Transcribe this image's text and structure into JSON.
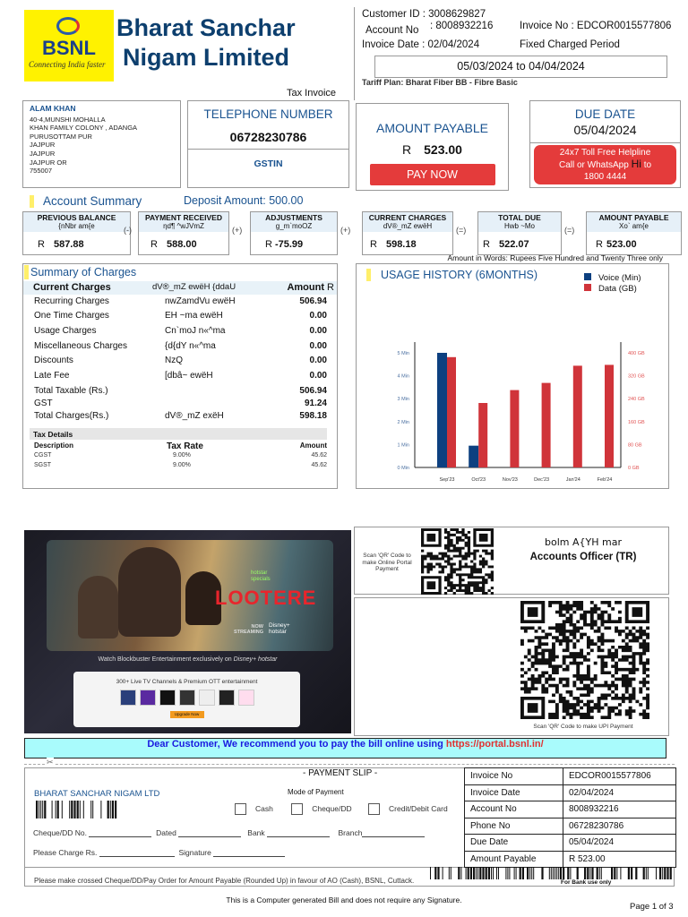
{
  "header": {
    "logo_text": "BSNL",
    "logo_tagline": "Connecting India faster",
    "company_line1": "Bharat Sanchar",
    "company_line2": "Nigam Limited",
    "tax_invoice": "Tax Invoice"
  },
  "meta": {
    "customer_id_label": "Customer ID",
    "customer_id": ": 3008629827",
    "account_no_label": "Account No",
    "account_no": ": 8008932216",
    "invoice_no": "Invoice No : EDCOR0015577806",
    "invoice_date_label": "Invoice Date",
    "invoice_date": ": 02/04/2024",
    "fixed_period_label": "Fixed Charged Period",
    "period": "05/03/2024 to 04/04/2024",
    "tariff": "Tariff Plan: Bharat Fiber BB - Fibre Basic"
  },
  "customer": {
    "name": "ALAM KHAN",
    "address": [
      "40-4,MUNSHI MOHALLA",
      "KHAN FAMILY COLONY , ADANGA",
      "PURUSOTTAM PUR",
      "JAJPUR",
      "JAJPUR",
      "JAJPUR OR",
      "755007"
    ]
  },
  "telephone": {
    "label": "TELEPHONE NUMBER",
    "number": "06728230786",
    "gstin_label": "GSTIN"
  },
  "amount": {
    "label": "AMOUNT PAYABLE",
    "currency": "R",
    "value": "523.00",
    "pay_now": "PAY NOW"
  },
  "due": {
    "label": "DUE DATE",
    "date": "05/04/2024",
    "helpline1": "24x7 Toll Free Helpline",
    "helpline2a": "Call or WhatsApp",
    "helpline2b": "Hi",
    "helpline2c": "to",
    "helpline3": "1800 4444"
  },
  "account_summary": {
    "title": "Account Summary",
    "deposit": "Deposit Amount: 500.00",
    "amount_words": "Amount in Words: Rupees Five Hundred and Twenty Three only",
    "boxes": [
      {
        "label": "PREVIOUS BALANCE",
        "sub": "{nNbr am{e",
        "value": "587.88"
      },
      {
        "label": "PAYMENT RECEIVED",
        "sub": "ηd¶ ^wJVmZ",
        "value": "588.00"
      },
      {
        "label": "ADJUSTMENTS",
        "sub": "g_m`moOZ",
        "value": "-75.99"
      },
      {
        "label": "CURRENT CHARGES",
        "sub": "dV®_mZ ewëH",
        "value": "598.18"
      },
      {
        "label": "TOTAL DUE",
        "sub": "Hwb ~Mo",
        "value": "522.07"
      },
      {
        "label": "AMOUNT PAYABLE",
        "sub": "Xo` am{e",
        "value": "523.00"
      }
    ],
    "operators": [
      "(-)",
      "(+)",
      "(+)",
      "(=)",
      "(=)"
    ],
    "currency": "R"
  },
  "charges": {
    "title": "Summary of Charges",
    "col1": "Current Charges",
    "col2": "dV®_mZ ewëH  {ddaU",
    "col3": "Amount",
    "col3_cur": "R",
    "rows": [
      {
        "label": "Recurring Charges",
        "alt": "nwZamdVu ewëH",
        "amount": "506.94"
      },
      {
        "label": "One Time Charges",
        "alt": "EH  ~ma ewëH",
        "amount": "0.00"
      },
      {
        "label": "Usage Charges",
        "alt": "Cn`moJ n«^ma",
        "amount": "0.00"
      },
      {
        "label": "Miscellaneous Charges",
        "alt": "{d{dY n«^ma",
        "amount": "0.00"
      },
      {
        "label": "Discounts",
        "alt": "NzQ",
        "amount": "0.00"
      },
      {
        "label": "Late Fee",
        "alt": "[dbâ~ ewëH",
        "amount": "0.00"
      },
      {
        "label": "Total Taxable (Rs.)",
        "alt": "",
        "amount": "506.94"
      },
      {
        "label": "GST",
        "alt": "",
        "amount": "91.24"
      },
      {
        "label": "Total Charges(Rs.)",
        "alt": "dV®_mZ exëH",
        "amount": "598.18"
      }
    ],
    "tax_title": "Tax Details",
    "tax_headers": [
      "Description",
      "Tax Rate",
      "Amount"
    ],
    "tax_rows": [
      [
        "CGST",
        "9.00%",
        "45.62"
      ],
      [
        "SGST",
        "9.00%",
        "45.62"
      ]
    ]
  },
  "chart_data": {
    "type": "bar",
    "title": "USAGE HISTORY (6MONTHS)",
    "categories": [
      "Sep'23",
      "Oct'23",
      "Nov'23",
      "Dec'23",
      "Jan'24",
      "Feb'24"
    ],
    "series": [
      {
        "name": "Voice (Min)",
        "values": [
          5,
          0.95,
          0,
          0,
          0,
          0
        ],
        "axis": "left",
        "color": "#0d4080"
      },
      {
        "name": "Data (GB)",
        "values": [
          385,
          225,
          270,
          295,
          355,
          358
        ],
        "axis": "right",
        "color": "#d0343a"
      }
    ],
    "left_ticks": [
      "0 Min",
      "1 Min",
      "2 Min",
      "3 Min",
      "4 Min",
      "5 Min"
    ],
    "right_ticks": [
      "0 GB",
      "80 GB",
      "160 GB",
      "240 GB",
      "320 GB",
      "400 GB"
    ],
    "ylim_left": [
      0,
      5
    ],
    "ylim_right": [
      0,
      400
    ],
    "legend": "top-right"
  },
  "ad": {
    "show_title": "LOOTERE",
    "brand": "hotstar specials",
    "now_streaming": "NOW STREAMING",
    "disney": "Disney+ hotstar",
    "watch": "Watch Blockbuster Entertainment exclusively on",
    "watch_brand": "Disney+ hotstar",
    "channels": "300+ Live TV Channels & Premium OTT entertainment",
    "upgrade": "Upgrade Now"
  },
  "qr": {
    "portal_caption": "Scan 'QR' Code to make Online Portal Payment",
    "signature": "bolm A{YH mar",
    "officer": "Accounts Officer (TR)",
    "upi_caption": "Scan 'QR' Code to make UPI Payment"
  },
  "banner": {
    "text": "Dear Customer, We recommend you to pay the bill online using",
    "url": "https://portal.bsnl.in/"
  },
  "slip": {
    "title": "- PAYMENT SLIP -",
    "company": "BHARAT SANCHAR NIGAM LTD",
    "mode_label": "Mode of Payment",
    "modes": [
      "Cash",
      "Cheque/DD",
      "Credit/Debit Card"
    ],
    "cheque_no": "Cheque/DD No.",
    "dated": "Dated",
    "bank": "Bank",
    "branch": "Branch",
    "charge": "Please Charge Rs.",
    "signature": "Signature",
    "note": "Please make crossed Cheque/DD/Pay Order for Amount Payable (Rounded Up) in favour of AO (Cash), BSNL, Cuttack.",
    "bank_use": "For Bank use only",
    "table": [
      [
        "Invoice No",
        "EDCOR0015577806"
      ],
      [
        "Invoice Date",
        "02/04/2024"
      ],
      [
        "Account No",
        "8008932216"
      ],
      [
        "Phone No",
        "06728230786"
      ],
      [
        "Due Date",
        "05/04/2024"
      ],
      [
        "Amount Payable",
        "R 523.00"
      ]
    ]
  },
  "footer": {
    "note": "This is a Computer generated Bill and does not require any Signature.",
    "page": "Page 1 of 3"
  }
}
